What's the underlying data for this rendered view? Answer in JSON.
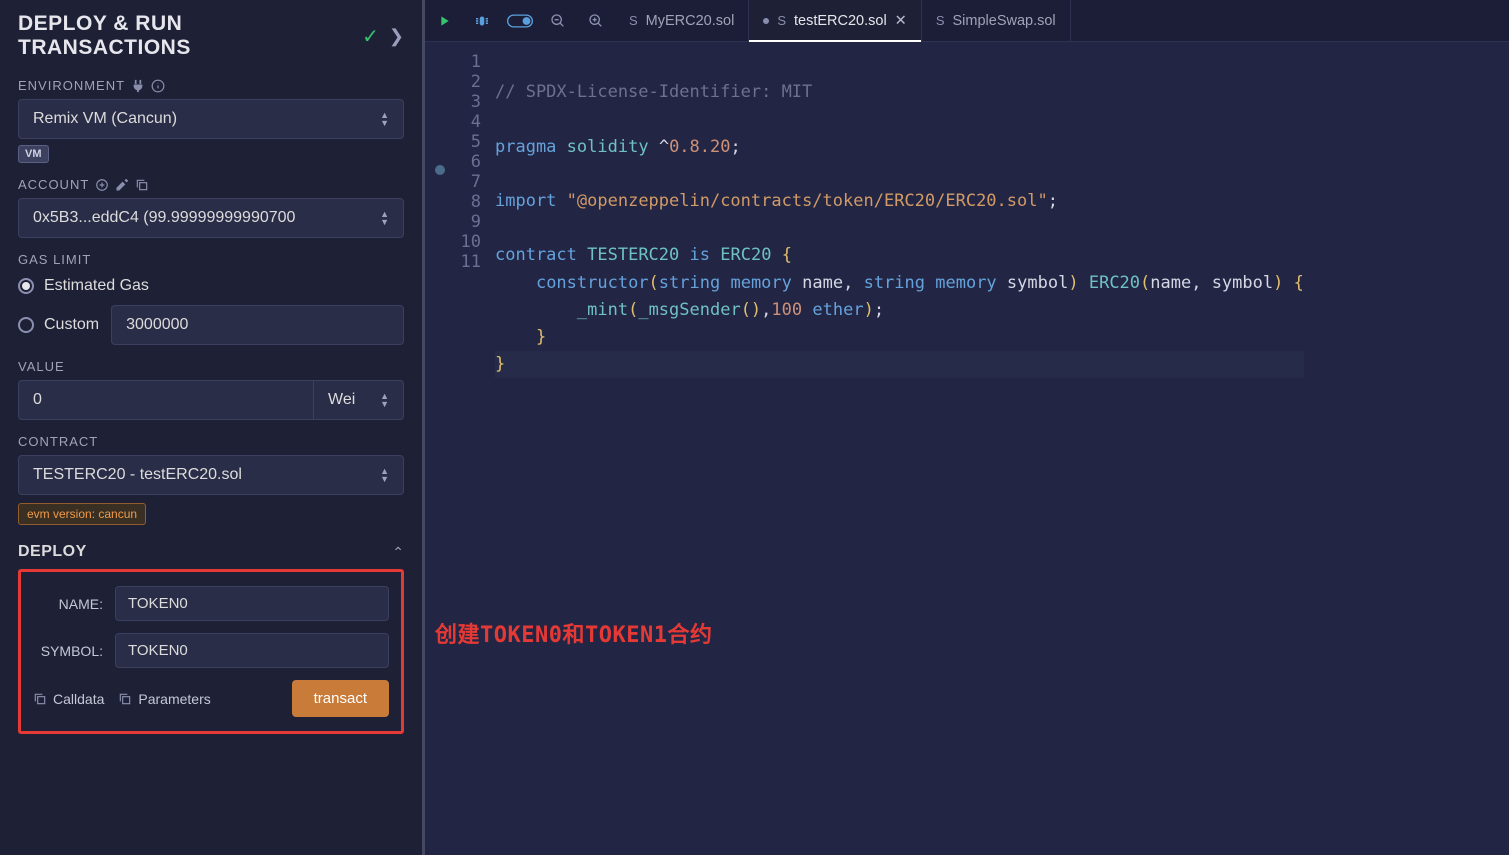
{
  "panel": {
    "title": "DEPLOY & RUN TRANSACTIONS",
    "env_label": "ENVIRONMENT",
    "env_value": "Remix VM (Cancun)",
    "env_badge": "VM",
    "account_label": "ACCOUNT",
    "account_value": "0x5B3...eddC4 (99.99999999990700",
    "gas_label": "GAS LIMIT",
    "gas_estimated": "Estimated Gas",
    "gas_custom_label": "Custom",
    "gas_custom_value": "3000000",
    "value_label": "VALUE",
    "value_amount": "0",
    "value_unit": "Wei",
    "contract_label": "CONTRACT",
    "contract_value": "TESTERC20 - testERC20.sol",
    "evm_badge": "evm version: cancun",
    "deploy_header": "DEPLOY",
    "params": {
      "name_label": "NAME:",
      "name_value": "TOKEN0",
      "symbol_label": "SYMBOL:",
      "symbol_value": "TOKEN0"
    },
    "calldata_btn": "Calldata",
    "parameters_btn": "Parameters",
    "transact_btn": "transact"
  },
  "tabs": [
    {
      "name": "MyERC20.sol",
      "active": false,
      "close": false
    },
    {
      "name": "testERC20.sol",
      "active": true,
      "close": true
    },
    {
      "name": "SimpleSwap.sol",
      "active": false,
      "close": false
    }
  ],
  "code": {
    "line1": "// SPDX-License-Identifier: MIT",
    "line3_kw1": "pragma",
    "line3_kw2": "solidity",
    "line3_ver": "^0.8.20",
    "line5_kw": "import",
    "line5_str": "\"@openzeppelin/contracts/token/ERC20/ERC20.sol\"",
    "line7_kw": "contract",
    "line7_name": "TESTERC20",
    "line7_is": "is",
    "line7_base": "ERC20",
    "line8_ctor": "constructor",
    "line8_string": "string",
    "line8_memory": "memory",
    "line8_p1": "name",
    "line8_p2": "symbol",
    "line8_base": "ERC20",
    "line9_mint": "_mint",
    "line9_msg": "_msgSender",
    "line9_num": "100",
    "line9_ether": "ether"
  },
  "annotation": "创建TOKEN0和TOKEN1合约"
}
